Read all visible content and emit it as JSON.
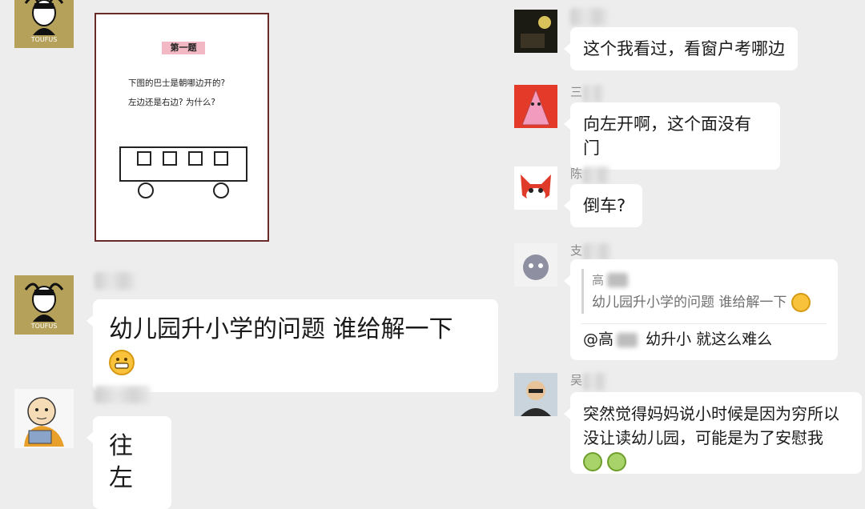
{
  "left_column": {
    "question_card": {
      "title": "第一题",
      "line1": "下图的巴士是朝哪边开的?",
      "line2": "左边还是右边? 为什么?"
    },
    "messages": [
      {
        "text": "幼儿园升小学的问题 谁给解一下",
        "emoji": "grinning-emoji"
      },
      {
        "text": "往左"
      }
    ],
    "avatar_label": "TOUFUS"
  },
  "right_column": {
    "messages": [
      {
        "text": "这个我看过，看窗户考哪边"
      },
      {
        "name_prefix": "三",
        "text": "向左开啊，这个面没有门"
      },
      {
        "name_prefix": "陈",
        "text": "倒车?"
      },
      {
        "name_prefix": "支",
        "quote_name": "高",
        "quote_text": "幼儿园升小学的问题 谁给解一下",
        "reply_prefix": "@高",
        "reply_text": "幼升小 就这么难么"
      },
      {
        "name_prefix": "吴",
        "text_line1": "突然觉得妈妈说小时候是因为穷所以",
        "text_line2": "没让读幼儿园，可能是为了安慰我"
      }
    ]
  },
  "colors": {
    "background": "#ededed",
    "bubble": "#ffffff",
    "card_border": "#6b2a2a",
    "title_pink": "#f2b8c4"
  }
}
